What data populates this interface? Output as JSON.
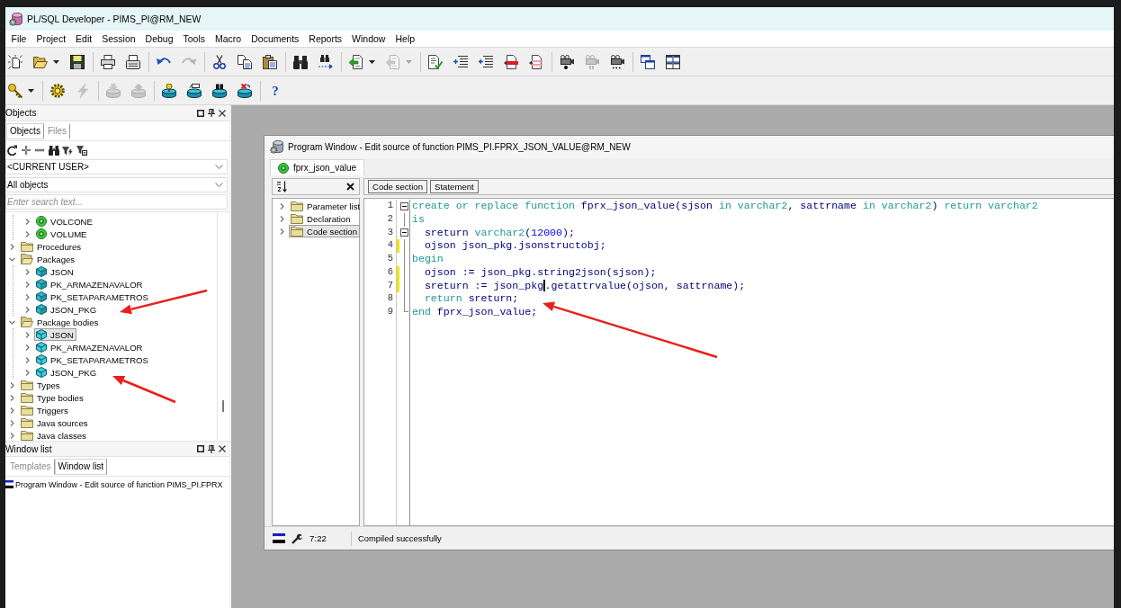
{
  "window": {
    "title": "PL/SQL Developer - PIMS_PI@RM_NEW"
  },
  "menu": [
    "File",
    "Project",
    "Edit",
    "Session",
    "Debug",
    "Tools",
    "Macro",
    "Documents",
    "Reports",
    "Window",
    "Help"
  ],
  "toolbars": [
    {
      "groups": [
        [
          {
            "disabled": false
          },
          {
            "disabled": false,
            "dropdown": true
          },
          {
            "disabled": false
          }
        ],
        [
          {
            "disabled": false
          },
          {
            "disabled": false
          }
        ],
        [
          {
            "disabled": false
          },
          {
            "disabled": true
          }
        ],
        [
          {
            "disabled": false
          },
          {
            "disabled": false
          },
          {
            "disabled": false
          }
        ],
        [
          {
            "disabled": false
          },
          {
            "disabled": false
          }
        ],
        [
          {
            "disabled": false,
            "dropdown": true
          },
          {
            "disabled": true,
            "dropdown": true
          }
        ],
        [
          {
            "disabled": false
          },
          {
            "disabled": false
          },
          {
            "disabled": false
          },
          {
            "disabled": false
          },
          {
            "disabled": false
          }
        ],
        [
          {
            "disabled": false
          },
          {
            "disabled": true
          },
          {
            "disabled": false
          }
        ],
        [
          {
            "disabled": false
          },
          {
            "disabled": false
          }
        ]
      ]
    },
    {
      "groups": [
        [
          {
            "disabled": false,
            "dropdown": true
          }
        ],
        [
          {
            "disabled": false
          },
          {
            "disabled": true
          }
        ],
        [
          {
            "disabled": true
          },
          {
            "disabled": true
          }
        ],
        [
          {
            "disabled": false
          },
          {
            "disabled": false
          },
          {
            "disabled": false
          },
          {
            "disabled": false
          }
        ],
        [
          {
            "label": "?",
            "disabled": false
          }
        ]
      ]
    }
  ],
  "objects_panel": {
    "title": "Objects",
    "tabs": [
      {
        "label": "Objects",
        "selected": true
      },
      {
        "label": "Files",
        "selected": false
      }
    ],
    "owner_filter": {
      "value": "<CURRENT USER>"
    },
    "type_filter": {
      "value": "All objects"
    },
    "search": {
      "placeholder": "Enter search text..."
    },
    "tree": [
      {
        "children": [
          {
            "label": "VOLCONE",
            "kind": "function",
            "expanded": false,
            "selected": false
          },
          {
            "label": "VOLUME",
            "kind": "function",
            "expanded": false,
            "selected": false
          }
        ]
      },
      {
        "label": "Procedures",
        "kind": "folder",
        "expanded": false,
        "selected": false
      },
      {
        "label": "Packages",
        "kind": "folder",
        "expanded": true,
        "selected": false,
        "children": [
          {
            "label": "JSON",
            "kind": "package",
            "expanded": false,
            "selected": false
          },
          {
            "label": "PK_ARMAZENAVALOR",
            "kind": "package",
            "expanded": false,
            "selected": false
          },
          {
            "label": "PK_SETAPARAMETROS",
            "kind": "package",
            "expanded": false,
            "selected": false
          },
          {
            "label": "JSON_PKG",
            "kind": "package",
            "expanded": false,
            "selected": false
          }
        ]
      },
      {
        "label": "Package bodies",
        "kind": "folder",
        "expanded": true,
        "selected": false,
        "children": [
          {
            "label": "JSON",
            "kind": "package_body",
            "expanded": false,
            "selected": true
          },
          {
            "label": "PK_ARMAZENAVALOR",
            "kind": "package_body",
            "expanded": false,
            "selected": false
          },
          {
            "label": "PK_SETAPARAMETROS",
            "kind": "package_body",
            "expanded": false,
            "selected": false
          },
          {
            "label": "JSON_PKG",
            "kind": "package_body",
            "expanded": false,
            "selected": false
          }
        ]
      },
      {
        "label": "Types",
        "kind": "folder",
        "expanded": false,
        "selected": false
      },
      {
        "label": "Type bodies",
        "kind": "folder",
        "expanded": false,
        "selected": false
      },
      {
        "label": "Triggers",
        "kind": "folder",
        "expanded": false,
        "selected": false
      },
      {
        "label": "Java sources",
        "kind": "folder",
        "expanded": false,
        "selected": false
      },
      {
        "label": "Java classes",
        "kind": "folder",
        "expanded": false,
        "selected": false
      }
    ]
  },
  "window_list_panel": {
    "title": "Window list",
    "tabs": [
      {
        "label": "Templates",
        "selected": false
      },
      {
        "label": "Window list",
        "selected": true
      }
    ],
    "items": [
      {
        "label": "Program Window - Edit source of function PIMS_PI.FPRX",
        "selected": false
      }
    ]
  },
  "program_window": {
    "title": "Program Window - Edit source of function PIMS_PI.FPRX_JSON_VALUE@RM_NEW",
    "tabs": [
      {
        "label": "fprx_json_value",
        "kind": "function",
        "selected": true
      }
    ],
    "outline": [
      {
        "label": "Parameter list",
        "expanded": false,
        "selected": false
      },
      {
        "label": "Declaration",
        "expanded": false,
        "selected": false
      },
      {
        "label": "Code section",
        "expanded": false,
        "selected": true
      }
    ],
    "section_buttons": [
      "Code section",
      "Statement"
    ],
    "code": [
      {
        "number": "1",
        "foldable": true,
        "changed": false,
        "tokens": [
          {
            "kind": "keyword",
            "text": "create or replace function "
          },
          {
            "kind": "name",
            "text": "fprx_json_value(sjson "
          },
          {
            "kind": "keyword",
            "text": "in varchar2"
          },
          {
            "kind": "name",
            "text": ", sattrname "
          },
          {
            "kind": "keyword",
            "text": "in varchar2"
          },
          {
            "kind": "name",
            "text": ") "
          },
          {
            "kind": "keyword",
            "text": "return varchar2"
          }
        ]
      },
      {
        "number": "2",
        "foldable": false,
        "changed": false,
        "tokens": [
          {
            "kind": "keyword",
            "text": "is"
          }
        ]
      },
      {
        "number": "3",
        "foldable": true,
        "changed": false,
        "tokens": [
          {
            "kind": "name",
            "text": "  sreturn "
          },
          {
            "kind": "keyword",
            "text": "varchar2"
          },
          {
            "kind": "name",
            "text": "("
          },
          {
            "kind": "number",
            "text": "12000"
          },
          {
            "kind": "name",
            "text": ");"
          }
        ]
      },
      {
        "number": "4",
        "foldable": false,
        "changed": true,
        "tokens": [
          {
            "kind": "name",
            "text": "  ojson json_pkg.jsonstructobj;"
          }
        ]
      },
      {
        "number": "5",
        "foldable": false,
        "changed": false,
        "tokens": [
          {
            "kind": "keyword",
            "text": "begin"
          }
        ]
      },
      {
        "number": "6",
        "foldable": false,
        "changed": true,
        "tokens": [
          {
            "kind": "name",
            "text": "  ojson := json_pkg.string2json(sjson);"
          }
        ]
      },
      {
        "number": "7",
        "foldable": false,
        "changed": true,
        "tokens": [
          {
            "kind": "name",
            "text": "  sreturn := json_pkg"
          },
          {
            "kind": "cursor"
          },
          {
            "kind": "name",
            "text": ".getattrvalue(ojson, sattrname);"
          }
        ]
      },
      {
        "number": "8",
        "foldable": false,
        "changed": false,
        "tokens": [
          {
            "kind": "keyword",
            "text": "  return"
          },
          {
            "kind": "name",
            "text": " sreturn;"
          }
        ]
      },
      {
        "number": "9",
        "foldable": false,
        "changed": false,
        "tokens": [
          {
            "kind": "keyword",
            "text": "end"
          },
          {
            "kind": "name",
            "text": " fprx_json_value;"
          }
        ]
      }
    ],
    "status": {
      "position": "7:22",
      "message": "Compiled successfully"
    }
  },
  "annotations": [
    {
      "kind": "arrow"
    },
    {
      "kind": "arrow"
    },
    {
      "kind": "arrow"
    }
  ]
}
